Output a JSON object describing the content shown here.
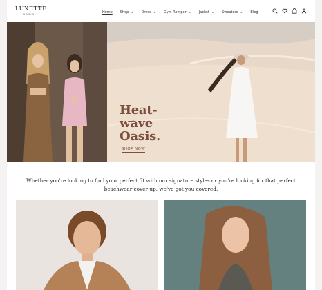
{
  "brand": {
    "name": "LUXETTE",
    "tagline": "OASIS"
  },
  "nav": {
    "items": [
      {
        "label": "Home",
        "has_dropdown": false,
        "active": true
      },
      {
        "label": "Shop",
        "has_dropdown": true,
        "active": false
      },
      {
        "label": "Dress",
        "has_dropdown": true,
        "active": false
      },
      {
        "label": "Gym Romper",
        "has_dropdown": true,
        "active": false
      },
      {
        "label": "Jacket",
        "has_dropdown": true,
        "active": false
      },
      {
        "label": "Sweaters",
        "has_dropdown": true,
        "active": false
      },
      {
        "label": "Blog",
        "has_dropdown": false,
        "active": false
      }
    ]
  },
  "header_icons": [
    "search-icon",
    "heart-icon",
    "bag-icon",
    "user-icon"
  ],
  "hero": {
    "title_line1": "Heat-",
    "title_line2": "wave",
    "title_line3": "Oasis.",
    "cta": "SHOP NOW"
  },
  "intro": {
    "text": "Whether you're looking to find your perfect fit with our signature styles or you're looking for that perfect beachwear cover-up, we've got you covered."
  },
  "colors": {
    "accent": "#7b4e3d",
    "text": "#222222",
    "background": "#ffffff"
  }
}
